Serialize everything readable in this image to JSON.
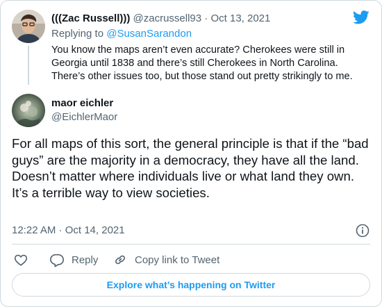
{
  "brand": {
    "logo_icon": "twitter-bird-icon",
    "accent_color": "#1d9bf0"
  },
  "parent_tweet": {
    "display_name": "(((Zac Russell)))",
    "handle": "@zacrussell93",
    "separator": "·",
    "date": "Oct 13, 2021",
    "replying_to_label": "Replying to",
    "replying_to_handle": "@SusanSarandon",
    "text": "You know the maps aren’t even accurate? Cherokees were still in Georgia until 1838 and there’s still Cherokees in North Carolina. There’s other issues too, but those stand out pretty strikingly to me."
  },
  "main_tweet": {
    "display_name": "maor eichler",
    "handle": "@EichlerMaor",
    "text": "For all maps of this sort, the general principle is that if the “bad guys” are the majority in a democracy, they have all the land. Doesn’t matter where individuals live or what land they own.\nIt’s a terrible way to view societies.",
    "timestamp": "12:22 AM · Oct 14, 2021"
  },
  "actions": {
    "like_icon": "heart-icon",
    "reply_icon": "reply-bubble-icon",
    "reply_label": "Reply",
    "copy_icon": "link-icon",
    "copy_label": "Copy link to Tweet",
    "info_icon": "info-icon"
  },
  "footer": {
    "explore_label": "Explore what’s happening on Twitter"
  }
}
